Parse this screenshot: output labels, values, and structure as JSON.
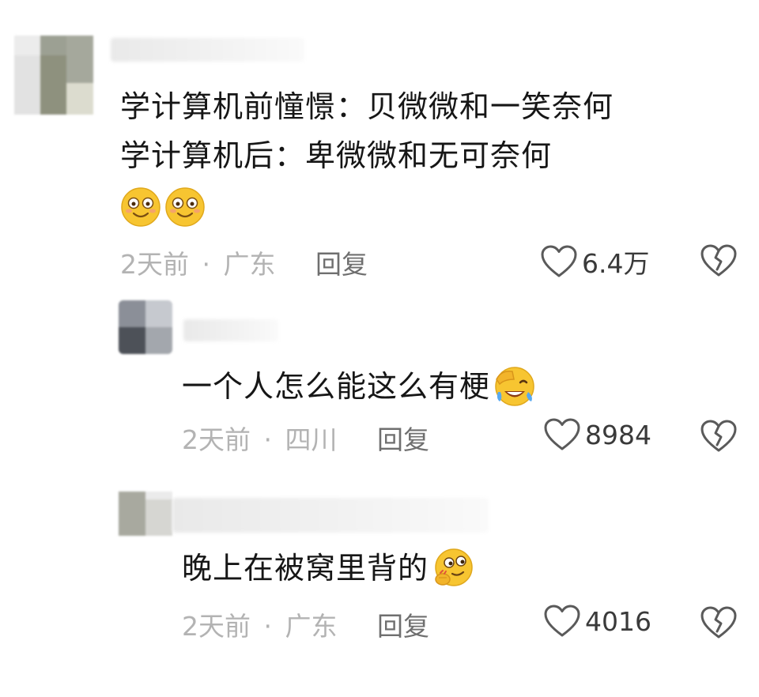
{
  "comments": [
    {
      "text_lines": [
        "学计算机前憧憬：贝微微和一笑奈何",
        "学计算机后：卑微微和无可奈何"
      ],
      "emojis": [
        "smile-emoji",
        "smile-emoji"
      ],
      "time": "2天前",
      "separator": "·",
      "location": "广东",
      "reply_label": "回复",
      "likes": "6.4万"
    },
    {
      "text_lines": [
        "一个人怎么能这么有梗"
      ],
      "emojis": [
        "facepalm-laugh-emoji"
      ],
      "time": "2天前",
      "separator": "·",
      "location": "四川",
      "reply_label": "回复",
      "likes": "8984"
    },
    {
      "text_lines": [
        "晚上在被窝里背的"
      ],
      "emojis": [
        "smirk-emoji"
      ],
      "time": "2天前",
      "separator": "·",
      "location": "广东",
      "reply_label": "回复",
      "likes": "4016"
    }
  ],
  "colors": {
    "text": "#161616",
    "meta": "#b3b3b3",
    "reply": "#6f6f6f",
    "icon": "#5a5a5a",
    "emoji_yellow": "#f7c531"
  }
}
